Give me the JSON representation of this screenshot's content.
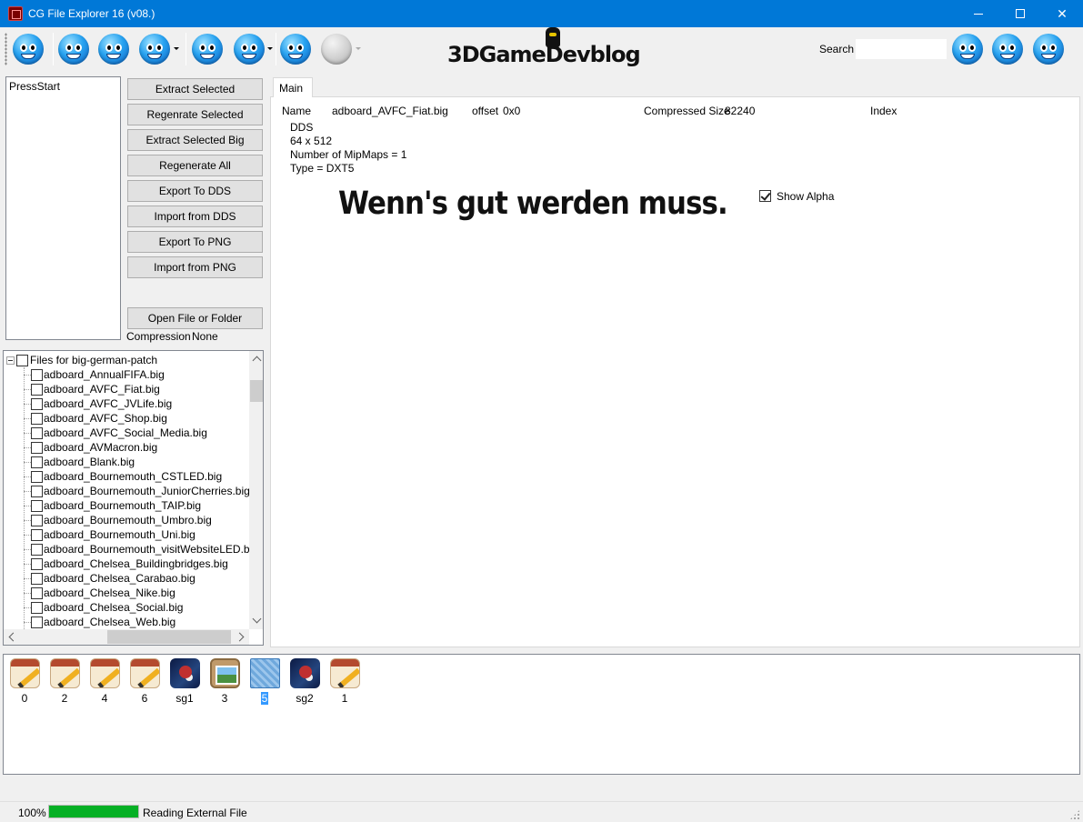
{
  "window": {
    "title": "CG File Explorer 16 (v08.)",
    "minimize_icon": "minimize-icon",
    "maximize_icon": "maximize-icon",
    "close_glyph": "✕"
  },
  "toolbar": {
    "logo_text": "3DGameDevblog",
    "search_label": "Search",
    "search_value": "",
    "icons": [
      "smiley-icon-1",
      "smiley-icon-2",
      "smiley-icon-3",
      "smiley-icon-4",
      "smiley-icon-5",
      "smiley-icon-6",
      "smiley-icon-7",
      "smiley-icon-8-disabled",
      "smiley-icon-9",
      "smiley-icon-10",
      "smiley-icon-11"
    ]
  },
  "left_panel": {
    "list_items": [
      "PressStart"
    ],
    "buttons": {
      "extract_selected": "Extract Selected",
      "regenerate_selected": "Regenrate Selected",
      "extract_selected_big": "Extract Selected Big",
      "regenerate_all": "Regenerate All",
      "export_dds": "Export To DDS",
      "import_dds": "Import from DDS",
      "export_png": "Export To PNG",
      "import_png": "Import from PNG",
      "open_file": "Open File or Folder"
    },
    "compression_label": "Compression",
    "compression_value": "None"
  },
  "tree": {
    "root": "Files for big-german-patch",
    "files": [
      "adboard_AnnualFIFA.big",
      "adboard_AVFC_Fiat.big",
      "adboard_AVFC_JVLife.big",
      "adboard_AVFC_Shop.big",
      "adboard_AVFC_Social_Media.big",
      "adboard_AVMacron.big",
      "adboard_Blank.big",
      "adboard_Bournemouth_CSTLED.big",
      "adboard_Bournemouth_JuniorCherries.big",
      "adboard_Bournemouth_TAIP.big",
      "adboard_Bournemouth_Umbro.big",
      "adboard_Bournemouth_Uni.big",
      "adboard_Bournemouth_visitWebsiteLED.big",
      "adboard_Chelsea_Buildingbridges.big",
      "adboard_Chelsea_Carabao.big",
      "adboard_Chelsea_Nike.big",
      "adboard_Chelsea_Social.big",
      "adboard_Chelsea_Web.big"
    ]
  },
  "main_tab": {
    "tab_label": "Main",
    "name_label": "Name",
    "name_value": "adboard_AVFC_Fiat.big",
    "offset_label": "offset",
    "offset_value": "0x0",
    "compressed_label": "Compressed Size",
    "compressed_value": "82240",
    "index_label": "Index",
    "format": "DDS",
    "dimensions": "64 x 512",
    "mipmaps": "Number of MipMaps = 1",
    "type": "Type = DXT5",
    "preview_text": "Wenn's gut werden muss.",
    "show_alpha_label": "Show Alpha",
    "show_alpha_checked": true
  },
  "thumbnails": [
    {
      "label": "0",
      "icon": "pencil-icon"
    },
    {
      "label": "2",
      "icon": "pencil-icon"
    },
    {
      "label": "4",
      "icon": "pencil-icon"
    },
    {
      "label": "6",
      "icon": "pencil-icon"
    },
    {
      "label": "sg1",
      "icon": "game-icon"
    },
    {
      "label": "3",
      "icon": "photo-icon"
    },
    {
      "label": "5",
      "icon": "pattern-icon",
      "selected": true
    },
    {
      "label": "sg2",
      "icon": "game-icon"
    },
    {
      "label": "1",
      "icon": "pencil-icon"
    }
  ],
  "status": {
    "percent": "100%",
    "progress": 1.0,
    "text": "Reading External File",
    "progress_color": "#06b025"
  }
}
